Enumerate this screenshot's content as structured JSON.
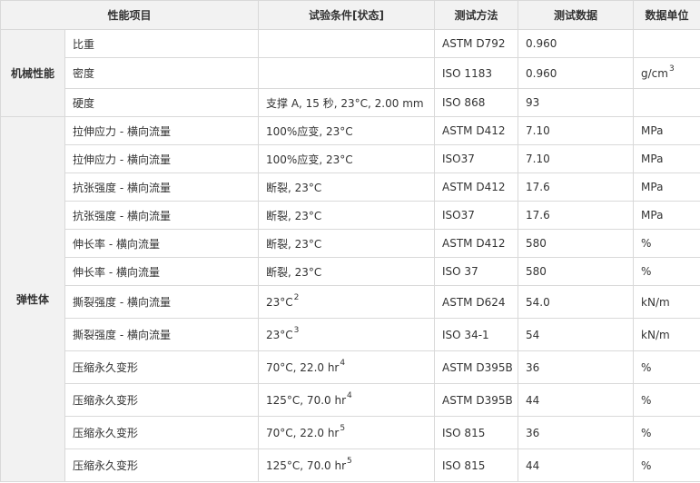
{
  "headers": [
    "性能项目",
    "试验条件[状态]",
    "测试方法",
    "测试数据",
    "数据单位"
  ],
  "categories": [
    {
      "label": "机械性能",
      "rows": [
        {
          "item": "比重",
          "cond": "",
          "cond_sup": "",
          "method": "ASTM D792",
          "value": "0.960",
          "unit": "",
          "unit_sup": ""
        },
        {
          "item": "密度",
          "cond": "",
          "cond_sup": "",
          "method": "ISO 1183",
          "value": "0.960",
          "unit": "g/cm",
          "unit_sup": "3"
        },
        {
          "item": "硬度",
          "cond": "支撑 A, 15 秒, 23°C, 2.00 mm",
          "cond_sup": "",
          "method": "ISO 868",
          "value": "93",
          "unit": "",
          "unit_sup": ""
        }
      ]
    },
    {
      "label": "弹性体",
      "rows": [
        {
          "item": "拉伸应力 - 横向流量",
          "cond": "100%应变, 23°C",
          "cond_sup": "",
          "method": "ASTM D412",
          "value": "7.10",
          "unit": "MPa",
          "unit_sup": ""
        },
        {
          "item": "拉伸应力 - 横向流量",
          "cond": "100%应变, 23°C",
          "cond_sup": "",
          "method": "ISO37",
          "value": "7.10",
          "unit": "MPa",
          "unit_sup": ""
        },
        {
          "item": "抗张强度 - 横向流量",
          "cond": "断裂, 23°C",
          "cond_sup": "",
          "method": "ASTM D412",
          "value": "17.6",
          "unit": "MPa",
          "unit_sup": ""
        },
        {
          "item": "抗张强度 - 横向流量",
          "cond": "断裂, 23°C",
          "cond_sup": "",
          "method": "ISO37",
          "value": "17.6",
          "unit": "MPa",
          "unit_sup": ""
        },
        {
          "item": "伸长率 - 横向流量",
          "cond": "断裂, 23°C",
          "cond_sup": "",
          "method": "ASTM D412",
          "value": "580",
          "unit": "%",
          "unit_sup": ""
        },
        {
          "item": "伸长率 - 横向流量",
          "cond": "断裂, 23°C",
          "cond_sup": "",
          "method": "ISO 37",
          "value": "580",
          "unit": "%",
          "unit_sup": ""
        },
        {
          "item": "撕裂强度 - 横向流量",
          "cond": "23°C",
          "cond_sup": "2",
          "method": "ASTM D624",
          "value": "54.0",
          "unit": "kN/m",
          "unit_sup": ""
        },
        {
          "item": "撕裂强度 - 横向流量",
          "cond": "23°C",
          "cond_sup": "3",
          "method": "ISO 34-1",
          "value": "54",
          "unit": "kN/m",
          "unit_sup": ""
        },
        {
          "item": "压缩永久变形",
          "cond": "70°C, 22.0 hr",
          "cond_sup": "4",
          "method": "ASTM D395B",
          "value": "36",
          "unit": "%",
          "unit_sup": ""
        },
        {
          "item": "压缩永久变形",
          "cond": "125°C, 70.0 hr",
          "cond_sup": "4",
          "method": "ASTM D395B",
          "value": "44",
          "unit": "%",
          "unit_sup": ""
        },
        {
          "item": "压缩永久变形",
          "cond": "70°C, 22.0 hr",
          "cond_sup": "5",
          "method": "ISO 815",
          "value": "36",
          "unit": "%",
          "unit_sup": ""
        },
        {
          "item": "压缩永久变形",
          "cond": "125°C, 70.0 hr",
          "cond_sup": "5",
          "method": "ISO 815",
          "value": "44",
          "unit": "%",
          "unit_sup": ""
        }
      ]
    }
  ]
}
